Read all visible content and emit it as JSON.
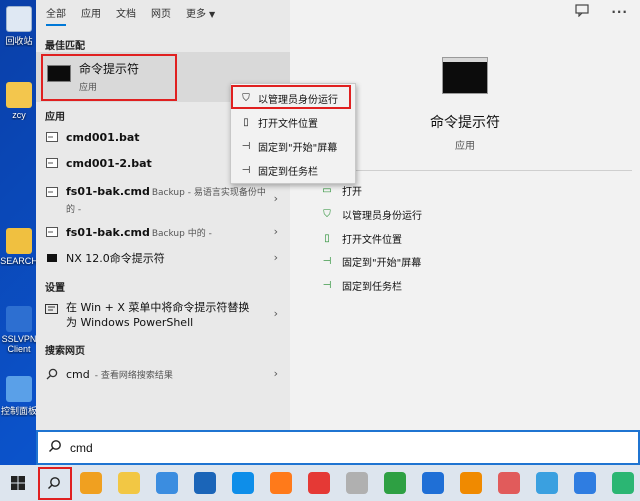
{
  "desktop": {
    "icons": [
      {
        "label": "回收站",
        "color": "#dfe8f3"
      },
      {
        "label": "zcy",
        "color": "#f3c64d"
      },
      {
        "label": "SEARCH",
        "color": "#f0c040"
      },
      {
        "label": "SSLVPN Client",
        "color": "#2d6fd1"
      },
      {
        "label": "控制面板",
        "color": "#5aa0e8"
      }
    ]
  },
  "tabs": [
    {
      "label": "全部",
      "active": true
    },
    {
      "label": "应用"
    },
    {
      "label": "文档"
    },
    {
      "label": "网页"
    },
    {
      "label": "更多",
      "dropdown": true
    }
  ],
  "toolbar": {
    "feedback_icon": "feedback-icon",
    "more_icon": "ellipsis-icon"
  },
  "sections": {
    "best_match": "最佳匹配",
    "apps": "应用",
    "settings": "设置",
    "web": "搜索网页"
  },
  "best_match": {
    "title": "命令提示符",
    "subtitle": "应用"
  },
  "apps": [
    {
      "name": "cmd001.bat",
      "hint": ""
    },
    {
      "name": "cmd001-2.bat",
      "hint": ""
    },
    {
      "name": "fs01-bak.cmd",
      "hint": "Backup - 易语言实现备份中的 -",
      "chevron": true
    },
    {
      "name": "fs01-bak.cmd",
      "hint": "Backup 中的 -",
      "chevron": true
    },
    {
      "name": "NX 12.0命令提示符",
      "hint": "",
      "chevron": true
    }
  ],
  "setting_item": {
    "text": "在 Win + X 菜单中将命令提示符替换为 Windows PowerShell"
  },
  "web_item": {
    "query": "cmd",
    "hint": "- 查看网络搜索结果"
  },
  "context_menu": [
    {
      "label": "以管理员身份运行",
      "icon": "shield-run-icon"
    },
    {
      "label": "打开文件位置",
      "icon": "folder-open-icon"
    },
    {
      "label": "固定到\"开始\"屏幕",
      "icon": "pin-icon"
    },
    {
      "label": "固定到任务栏",
      "icon": "pin-icon"
    }
  ],
  "detail": {
    "title": "命令提示符",
    "subtitle": "应用",
    "actions": [
      {
        "label": "打开",
        "icon": "open-icon"
      },
      {
        "label": "以管理员身份运行",
        "icon": "shield-run-icon"
      },
      {
        "label": "打开文件位置",
        "icon": "folder-open-icon"
      },
      {
        "label": "固定到\"开始\"屏幕",
        "icon": "pin-icon"
      },
      {
        "label": "固定到任务栏",
        "icon": "pin-icon"
      }
    ]
  },
  "search": {
    "value": "cmd"
  },
  "taskbar": {
    "apps": [
      {
        "name": "outlook-icon",
        "color": "#f0a020"
      },
      {
        "name": "file-explorer-icon",
        "color": "#f2c744"
      },
      {
        "name": "browser-icon",
        "color": "#3b8de0"
      },
      {
        "name": "virtualbox-icon",
        "color": "#1b65b8"
      },
      {
        "name": "teamviewer-icon",
        "color": "#0e8ee9"
      },
      {
        "name": "firefox-icon",
        "color": "#ff7a1a"
      },
      {
        "name": "app-red-icon",
        "color": "#e53935"
      },
      {
        "name": "app-grey-icon",
        "color": "#b0b0b0"
      },
      {
        "name": "ie-icon",
        "color": "#2ea043"
      },
      {
        "name": "upload-icon",
        "color": "#1f6fd6"
      },
      {
        "name": "search-app-icon",
        "color": "#f08a00"
      },
      {
        "name": "snip-icon",
        "color": "#e15b5b"
      },
      {
        "name": "paint-icon",
        "color": "#3aa0e0"
      },
      {
        "name": "baidu-icon",
        "color": "#2f7de1"
      },
      {
        "name": "green-app-icon",
        "color": "#2bb673"
      }
    ]
  }
}
